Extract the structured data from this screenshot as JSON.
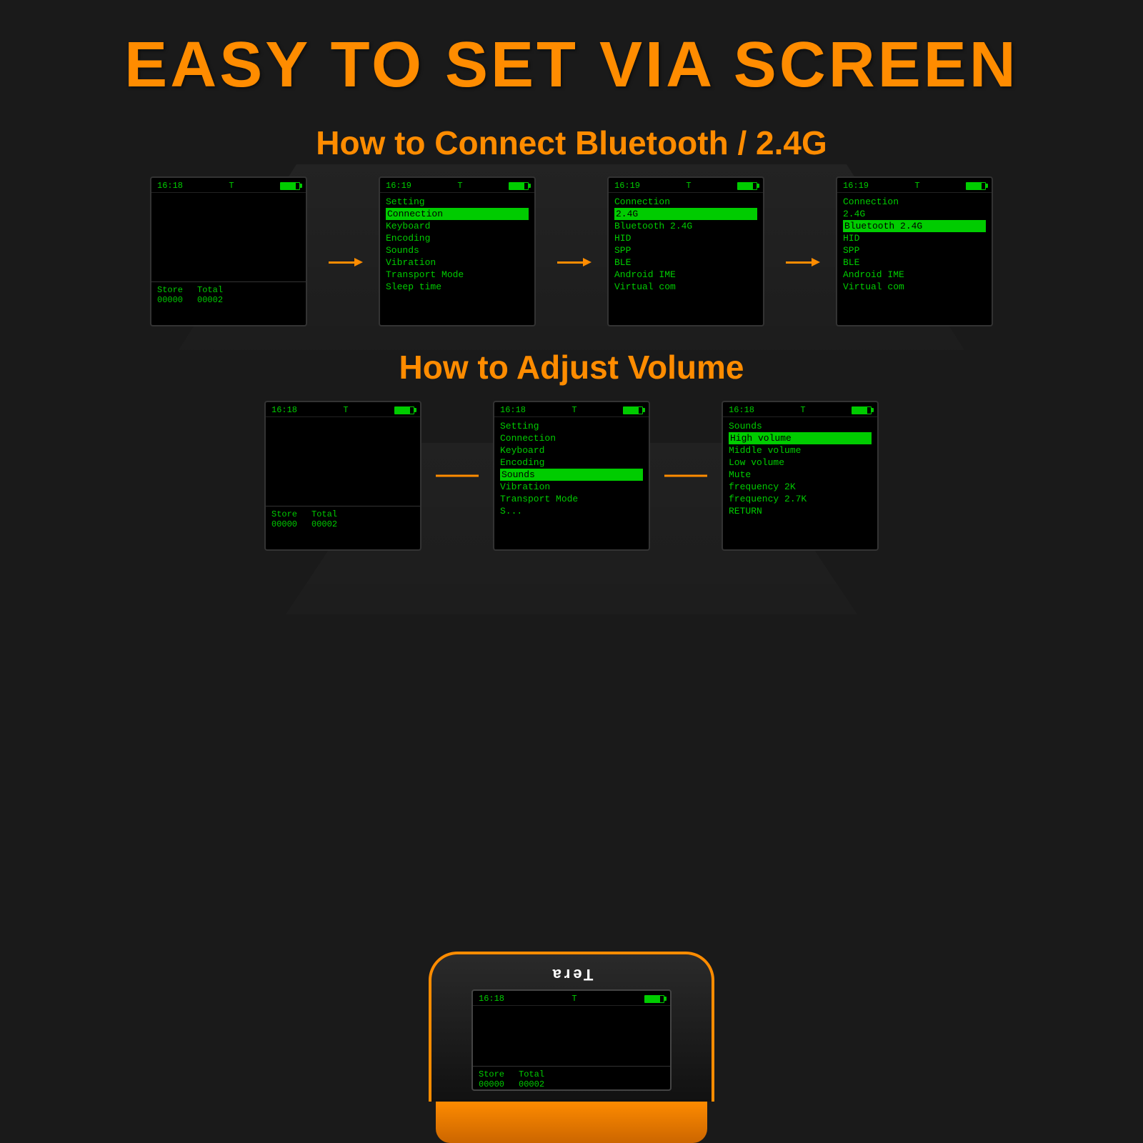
{
  "page": {
    "title": "EASY TO SET VIA SCREEN",
    "background_color": "#1a1a1a"
  },
  "section_bluetooth": {
    "title": "How to Connect Bluetooth / 2.4G",
    "screens": [
      {
        "id": "bt-screen-1",
        "time": "16:18",
        "signal": "T",
        "items": [],
        "footer": {
          "store_label": "Store",
          "store_val": "00000",
          "total_label": "Total",
          "total_val": "00002"
        }
      },
      {
        "id": "bt-screen-2",
        "time": "16:19",
        "signal": "T",
        "items": [
          {
            "text": "Setting",
            "highlighted": false
          },
          {
            "text": "Connection",
            "highlighted": true
          },
          {
            "text": "Keyboard",
            "highlighted": false
          },
          {
            "text": "Encoding",
            "highlighted": false
          },
          {
            "text": "Sounds",
            "highlighted": false
          },
          {
            "text": "Vibration",
            "highlighted": false
          },
          {
            "text": "Transport Mode",
            "highlighted": false
          },
          {
            "text": "Sleep time",
            "highlighted": false
          }
        ]
      },
      {
        "id": "bt-screen-3",
        "time": "16:19",
        "signal": "T",
        "items": [
          {
            "text": "Connection",
            "highlighted": false
          },
          {
            "text": "2.4G",
            "highlighted": true
          },
          {
            "text": "Bluetooth 2.4G",
            "highlighted": false
          },
          {
            "text": "HID",
            "highlighted": false
          },
          {
            "text": "SPP",
            "highlighted": false
          },
          {
            "text": "BLE",
            "highlighted": false
          },
          {
            "text": "Android IME",
            "highlighted": false
          },
          {
            "text": "Virtual com",
            "highlighted": false
          }
        ]
      },
      {
        "id": "bt-screen-4",
        "time": "16:19",
        "signal": "T",
        "items": [
          {
            "text": "Connection",
            "highlighted": false
          },
          {
            "text": "2.4G",
            "highlighted": false
          },
          {
            "text": "Bluetooth 2.4G",
            "highlighted": true
          },
          {
            "text": "HID",
            "highlighted": false
          },
          {
            "text": "SPP",
            "highlighted": false
          },
          {
            "text": "BLE",
            "highlighted": false
          },
          {
            "text": "Android IME",
            "highlighted": false
          },
          {
            "text": "Virtual com",
            "highlighted": false
          }
        ]
      }
    ]
  },
  "section_volume": {
    "title": "How to Adjust Volume",
    "screens": [
      {
        "id": "vol-screen-1",
        "time": "16:18",
        "signal": "T",
        "items": [],
        "footer": {
          "store_label": "Store",
          "store_val": "00000",
          "total_label": "Total",
          "total_val": "00002"
        }
      },
      {
        "id": "vol-screen-2",
        "time": "16:18",
        "signal": "T",
        "items": [
          {
            "text": "Setting",
            "highlighted": false
          },
          {
            "text": "Connection",
            "highlighted": false
          },
          {
            "text": "Keyboard",
            "highlighted": false
          },
          {
            "text": "Encoding",
            "highlighted": false
          },
          {
            "text": "Sounds",
            "highlighted": true
          },
          {
            "text": "Vibration",
            "highlighted": false
          },
          {
            "text": "Transport Mode",
            "highlighted": false
          },
          {
            "text": "S...",
            "highlighted": false
          }
        ]
      },
      {
        "id": "vol-screen-3",
        "time": "16:18",
        "signal": "T",
        "items": [
          {
            "text": "Sounds",
            "highlighted": false
          },
          {
            "text": "High volume",
            "highlighted": true
          },
          {
            "text": "Middle volume",
            "highlighted": false
          },
          {
            "text": "Low volume",
            "highlighted": false
          },
          {
            "text": "Mute",
            "highlighted": false
          },
          {
            "text": "frequency 2K",
            "highlighted": false
          },
          {
            "text": "frequency 2.7K",
            "highlighted": false
          },
          {
            "text": "RETURN",
            "highlighted": false
          }
        ]
      }
    ]
  },
  "bottom_device": {
    "time": "16:18",
    "signal": "T",
    "label": "Tera",
    "footer": {
      "store_label": "Store",
      "store_val": "00000",
      "total_label": "Total",
      "total_val": "00002"
    }
  }
}
